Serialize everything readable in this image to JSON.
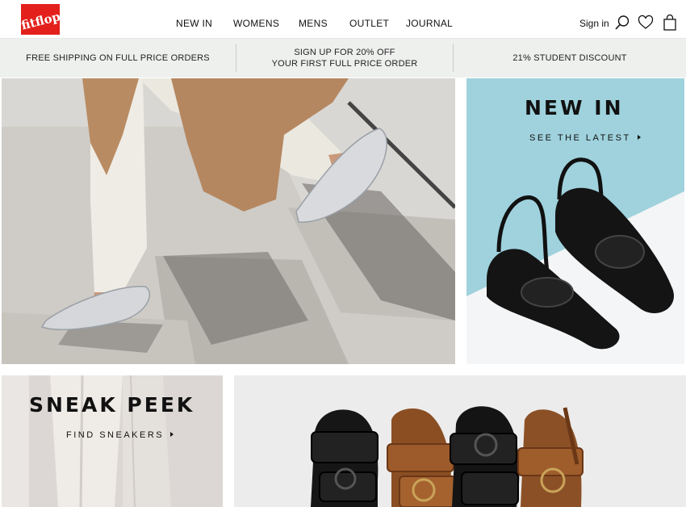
{
  "brand": {
    "logo_text": "fitflop"
  },
  "nav": {
    "items": [
      "NEW IN",
      "WOMENS",
      "MENS",
      "OUTLET",
      "JOURNAL"
    ]
  },
  "header_actions": {
    "sign_in": "Sign in",
    "icons": [
      "search-icon",
      "heart-icon",
      "bag-icon"
    ]
  },
  "promo": {
    "left": "FREE SHIPPING ON FULL PRICE ORDERS",
    "center_line1": "SIGN UP FOR 20% OFF",
    "center_line2": "YOUR FIRST FULL PRICE ORDER",
    "right": "21% STUDENT DISCOUNT"
  },
  "tiles": {
    "new_in": {
      "title": "NEW IN",
      "cta": "SEE THE LATEST"
    },
    "sneak_peek": {
      "title": "SNEAK PEEK",
      "cta": "FIND SNEAKERS"
    }
  },
  "colors": {
    "brand_red": "#e3201b",
    "promo_bg": "#eef0ee",
    "new_in_bg": "#9fd2dd"
  }
}
